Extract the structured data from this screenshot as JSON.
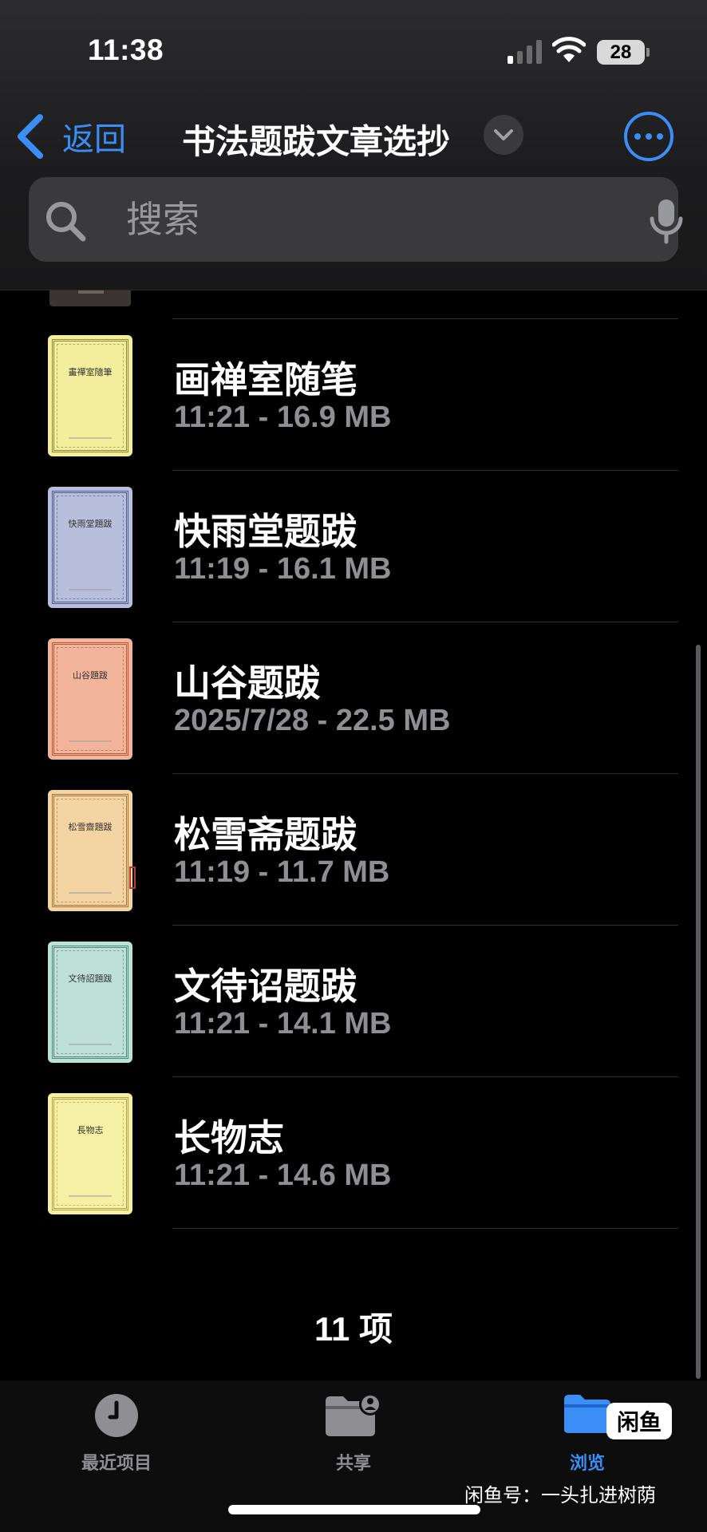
{
  "status_bar": {
    "time": "11:38",
    "battery": "28"
  },
  "nav": {
    "back_label": "返回",
    "title": "书法题跋文章选抄"
  },
  "search": {
    "placeholder": "搜索"
  },
  "files": [
    {
      "name": "画禅室随笔",
      "meta": "11:21 - 16.9 MB",
      "cover_title": "畫禪室隨筆",
      "cover_color": "#f2ee9c",
      "border_color": "#8a8a3a"
    },
    {
      "name": "快雨堂题跋",
      "meta": "11:19 - 16.1 MB",
      "cover_title": "快雨堂題跋",
      "cover_color": "#b7bfdc",
      "border_color": "#4d5a8c"
    },
    {
      "name": "山谷题跋",
      "meta": "2025/7/28 - 22.5 MB",
      "cover_title": "山谷題跋",
      "cover_color": "#f2b49a",
      "border_color": "#b4563a"
    },
    {
      "name": "松雪斋题跋",
      "meta": "11:19 - 11.7 MB",
      "cover_title": "松雪齋題跋",
      "cover_color": "#f4d4a2",
      "border_color": "#a3743a"
    },
    {
      "name": "文待诏题跋",
      "meta": "11:21 - 14.1 MB",
      "cover_title": "文待詔題跋",
      "cover_color": "#bfe0d6",
      "border_color": "#4c8a78"
    },
    {
      "name": "长物志",
      "meta": "11:21 - 14.6 MB",
      "cover_title": "長物志",
      "cover_color": "#f6f0a4",
      "border_color": "#b0a04a"
    }
  ],
  "item_count": "11 项",
  "tabs": [
    {
      "label": "最近项目",
      "icon": "clock-icon"
    },
    {
      "label": "共享",
      "icon": "shared-folder-icon"
    },
    {
      "label": "浏览",
      "icon": "folder-icon",
      "active": true
    }
  ],
  "watermark": {
    "logo": "闲鱼",
    "text": "闲鱼号：一头扎进树荫"
  },
  "colors": {
    "accent": "#3a8ef6",
    "secondary_text": "#8e8e93",
    "background": "#000000"
  }
}
